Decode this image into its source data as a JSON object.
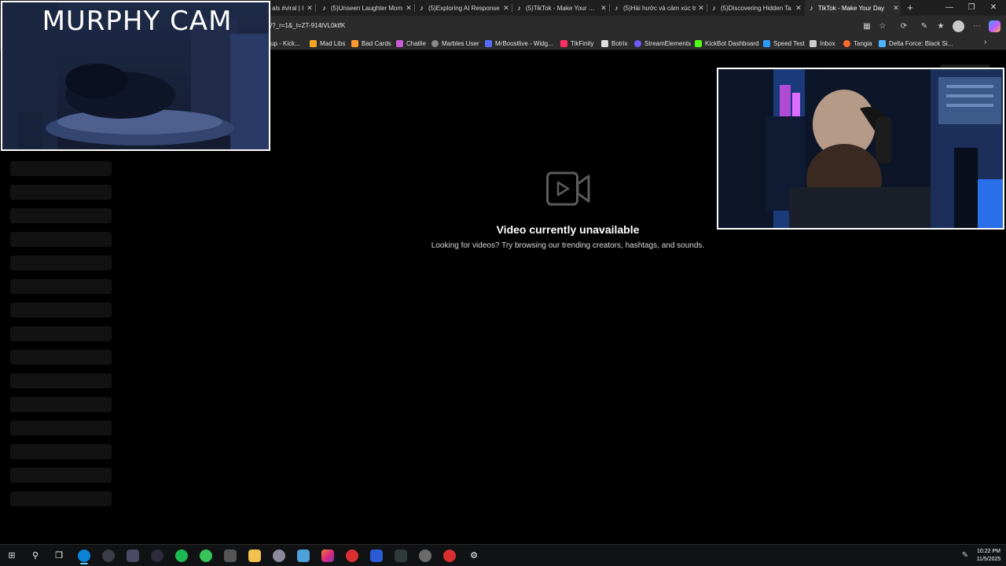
{
  "browser": {
    "tabs": [
      {
        "label": "als #viral | I",
        "active": false
      },
      {
        "label": "(5)Unseen Laughter Mom",
        "active": false
      },
      {
        "label": "(5)Exploring AI Response",
        "active": false
      },
      {
        "label": "(5)TikTok - Make Your Day",
        "active": false
      },
      {
        "label": "(5)Hài hước và cảm xúc tr",
        "active": false
      },
      {
        "label": "(5)Discovering Hidden Ta",
        "active": false
      },
      {
        "label": "TikTok - Make Your Day",
        "active": true
      }
    ],
    "tab_close_glyph": "✕",
    "new_tab_glyph": "+",
    "window_controls": {
      "minimize": "—",
      "restore": "❐",
      "close": "✕"
    },
    "url": "/?_r=1&_t=ZT-914tVL0ktfK",
    "bookmarks": [
      {
        "label": "up - Kick...",
        "color": "#2b2b2b"
      },
      {
        "label": "Mad Libs",
        "color": "#f5a623"
      },
      {
        "label": "Bad Cards",
        "color": "#ff9a2e"
      },
      {
        "label": "Chatlie",
        "color": "#c85bd6"
      },
      {
        "label": "Marbles User",
        "color": "#8a8a8a"
      },
      {
        "label": "MrBoostlive - Widg...",
        "color": "#5a6cff"
      },
      {
        "label": "TikFinity",
        "color": "#ff2e63"
      },
      {
        "label": "Botrix",
        "color": "#dddddd"
      },
      {
        "label": "StreamElements",
        "color": "#6f5bff"
      },
      {
        "label": "KickBot Dashboard",
        "color": "#53fc18"
      },
      {
        "label": "Speed Test",
        "color": "#2e9bff"
      },
      {
        "label": "Inbox",
        "color": "#cccccc"
      },
      {
        "label": "Tangia",
        "color": "#ff6b2e"
      },
      {
        "label": "Delta Force: Black Si...",
        "color": "#4db6ff"
      }
    ],
    "bookmarks_more_glyph": "›"
  },
  "overlays": {
    "left_cam_title": "MURPHY CAM"
  },
  "page": {
    "title": "Video currently unavailable",
    "subtitle": "Looking for videos? Try browsing our trending creators, hashtags, and sounds.",
    "skeleton_count": 15
  },
  "taskbar": {
    "time": "10:22 PM",
    "date": "11/5/2025"
  },
  "colors": {
    "accent": "#60cdff",
    "page_bg": "#000000"
  }
}
